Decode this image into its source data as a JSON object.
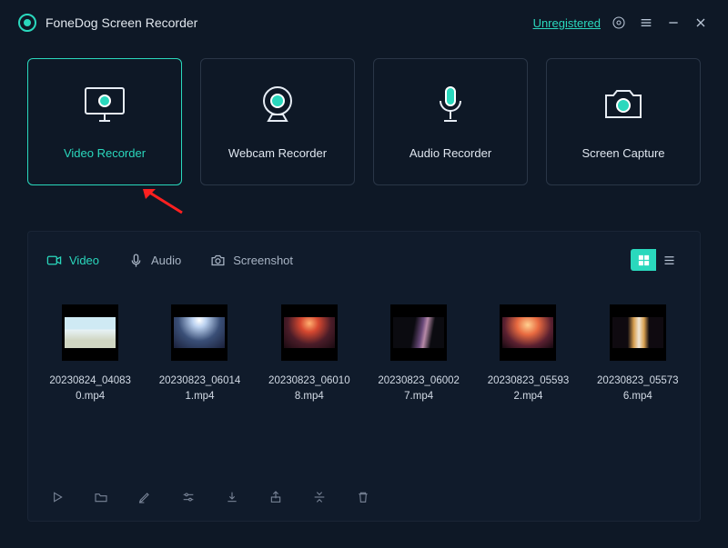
{
  "app": {
    "title": "FoneDog Screen Recorder",
    "unregistered_label": "Unregistered"
  },
  "modes": {
    "video": "Video Recorder",
    "webcam": "Webcam Recorder",
    "audio": "Audio Recorder",
    "capture": "Screen Capture"
  },
  "library": {
    "tabs": {
      "video": "Video",
      "audio": "Audio",
      "screenshot": "Screenshot"
    },
    "files": [
      {
        "name": "20230824_040830.mp4"
      },
      {
        "name": "20230823_060141.mp4"
      },
      {
        "name": "20230823_060108.mp4"
      },
      {
        "name": "20230823_060027.mp4"
      },
      {
        "name": "20230823_055932.mp4"
      },
      {
        "name": "20230823_055736.mp4"
      }
    ]
  }
}
